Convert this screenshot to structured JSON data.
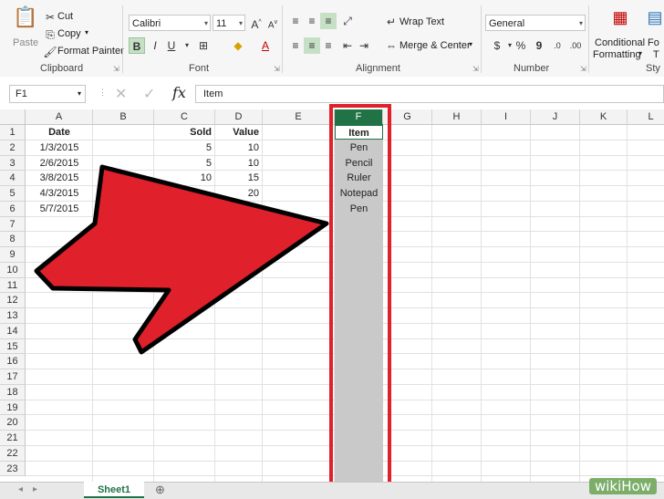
{
  "ribbon": {
    "clipboard": {
      "paste": "Paste",
      "cut": "Cut",
      "copy": "Copy",
      "format_painter": "Format Painter",
      "label": "Clipboard"
    },
    "font": {
      "name": "Calibri",
      "size": "11",
      "bold": "B",
      "italic": "I",
      "underline": "U",
      "label": "Font"
    },
    "alignment": {
      "wrap_text": "Wrap Text",
      "merge_center": "Merge & Center",
      "label": "Alignment"
    },
    "number": {
      "format": "General",
      "currency": "$",
      "percent": "%",
      "comma": "9",
      "label": "Number"
    },
    "styles": {
      "conditional_formatting_1": "Conditional",
      "conditional_formatting_2": "Formatting",
      "format_as_1": "Fo",
      "format_as_2": "T",
      "label": "Sty"
    }
  },
  "formula_bar": {
    "name_box": "F1",
    "fx": "fx",
    "value": "Item"
  },
  "columns": [
    "A",
    "B",
    "C",
    "D",
    "E",
    "F",
    "G",
    "H",
    "I",
    "J",
    "K",
    "L"
  ],
  "rows": [
    "1",
    "2",
    "3",
    "4",
    "5",
    "6",
    "7",
    "8",
    "9",
    "10",
    "11",
    "12",
    "13",
    "14",
    "15",
    "16",
    "17",
    "18",
    "19",
    "20",
    "21",
    "22",
    "23"
  ],
  "cells": {
    "A": [
      "Date",
      "1/3/2015",
      "2/6/2015",
      "3/8/2015",
      "4/3/2015",
      "5/7/2015"
    ],
    "C": [
      "Sold",
      "5",
      "5",
      "10",
      "",
      ""
    ],
    "D": [
      "Value",
      "10",
      "10",
      "15",
      "20",
      ""
    ],
    "F": [
      "Item",
      "Pen",
      "Pencil",
      "Ruler",
      "Notepad",
      "Pen"
    ]
  },
  "sheet_tab": "Sheet1",
  "watermark": "wikiHow",
  "colors": {
    "accent_green": "#217346",
    "arrow_red": "#e0202a",
    "selection_gray": "#c9c9c9"
  }
}
